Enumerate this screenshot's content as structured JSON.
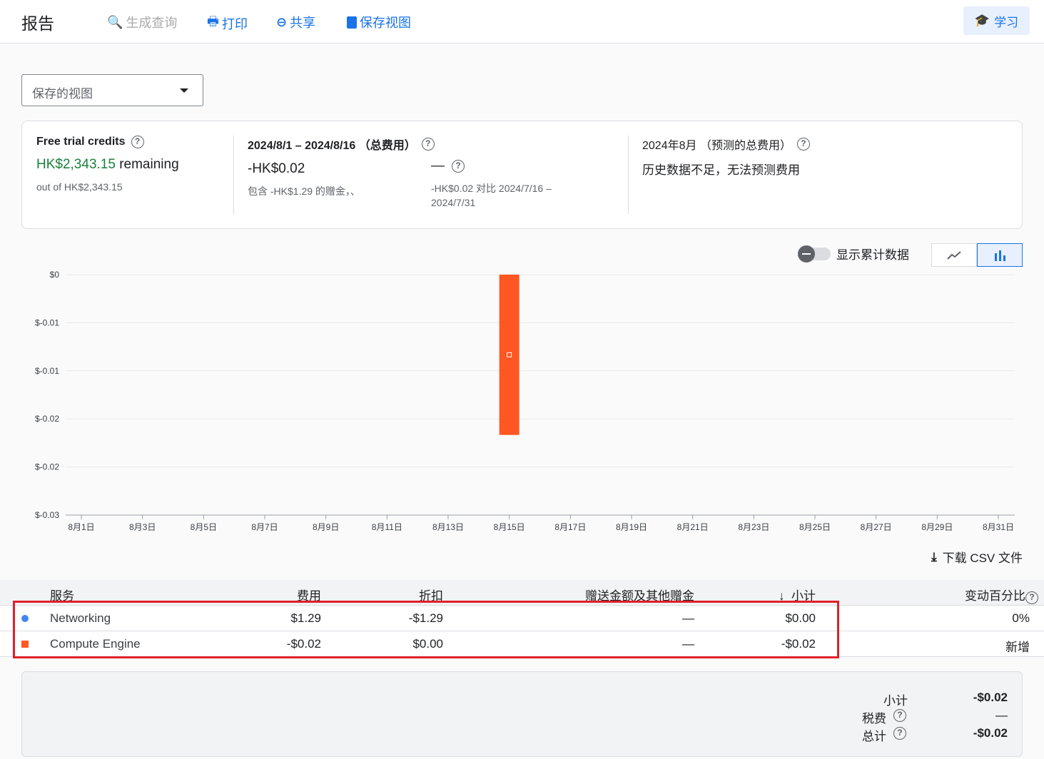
{
  "header": {
    "title": "报告",
    "generate_query": "生成查询",
    "print": "打印",
    "share": "共享",
    "save_view": "保存视图",
    "learn": "学习"
  },
  "saved_views": {
    "value": "保存的视图"
  },
  "summary_card": {
    "credits": {
      "title": "Free trial credits",
      "remaining_amount": "HK$2,343.15",
      "remaining_label": "remaining",
      "out_of": "out of HK$2,343.15"
    },
    "period": {
      "title": "2024/8/1 – 2024/8/16 （总费用）",
      "amount": "-HK$0.02",
      "note": "包含 -HK$1.29 的赠金，、",
      "change": "—",
      "compare": "-HK$0.02 对比 2024/7/16 – 2024/7/31"
    },
    "forecast": {
      "title": "2024年8月 （预测的总费用）",
      "text": "历史数据不足，无法预测费用"
    }
  },
  "chart_controls": {
    "cumulative_label": "显示累计数据",
    "cumulative_on": false,
    "selected_type": "bar"
  },
  "chart_data": {
    "type": "bar",
    "y_ticks": [
      "$0",
      "$-0.01",
      "$-0.01",
      "$-0.02",
      "$-0.02",
      "$-0.03"
    ],
    "ylim": [
      -0.03,
      0
    ],
    "x_ticks": [
      "8月1日",
      "8月3日",
      "8月5日",
      "8月7日",
      "8月9日",
      "8月11日",
      "8月13日",
      "8月15日",
      "8月17日",
      "8月19日",
      "8月21日",
      "8月23日",
      "8月25日",
      "8月27日",
      "8月29日",
      "8月31日"
    ],
    "days": 31,
    "bars": [
      {
        "day": 15,
        "value": -0.02,
        "series": "Compute Engine",
        "color": "#ff5722"
      }
    ]
  },
  "download_csv": "下载 CSV 文件",
  "table": {
    "headers": {
      "service": "服务",
      "cost": "费用",
      "discount": "折扣",
      "credits": "赠送金额及其他赠金",
      "subtotal": "小计",
      "change": "变动百分比"
    },
    "rows": [
      {
        "service": "Networking",
        "color": "#4285f4",
        "cost": "$1.29",
        "discount": "-$1.29",
        "credits": "—",
        "subtotal": "$0.00",
        "change": "0%"
      },
      {
        "service": "Compute Engine",
        "color": "#ff5722",
        "cost": "-$0.02",
        "discount": "$0.00",
        "credits": "—",
        "subtotal": "-$0.02",
        "change": "新增"
      }
    ]
  },
  "totals": {
    "subtotal_label": "小计",
    "subtotal": "-$0.02",
    "tax_label": "税费",
    "tax": "—",
    "total_label": "总计",
    "total": "-$0.02"
  }
}
